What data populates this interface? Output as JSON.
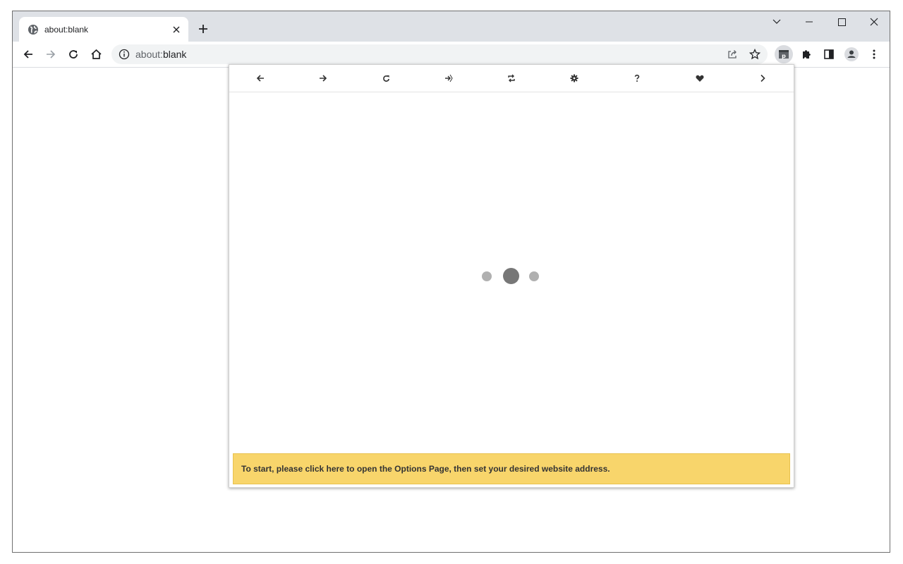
{
  "browser": {
    "tab": {
      "title": "about:blank"
    },
    "omnibox": {
      "url_prefix": "about:",
      "url_host": "blank"
    }
  },
  "icons": {
    "tab_favicon": "globe-icon",
    "tab_close": "close-icon",
    "new_tab": "plus-icon",
    "tab_search": "chevron-down-icon",
    "minimize": "minimize-icon",
    "maximize": "maximize-icon",
    "close_window": "close-icon",
    "back": "arrow-left-icon",
    "forward": "arrow-right-icon",
    "reload": "reload-icon",
    "home": "home-icon",
    "site_info": "info-icon",
    "share": "share-icon",
    "bookmark": "star-icon",
    "extension_active": "extension-p-icon",
    "extensions": "puzzle-icon",
    "side_panel": "side-panel-icon",
    "profile": "profile-icon",
    "menu": "kebab-menu-icon"
  },
  "popup": {
    "nav": [
      "arrow-left-icon",
      "arrow-right-icon",
      "reload-icon",
      "sign-in-icon",
      "retweet-icon",
      "gear-icon",
      "question-icon",
      "heart-icon",
      "chevron-right-icon"
    ],
    "banner_text": "To start, please click here to open the Options Page, then set your desired website address."
  },
  "colors": {
    "tabstrip": "#dee1e6",
    "omnibox": "#f1f3f4",
    "banner": "#f8d56b",
    "spinner_dark": "#777777",
    "spinner_light": "#b0b0b0"
  }
}
